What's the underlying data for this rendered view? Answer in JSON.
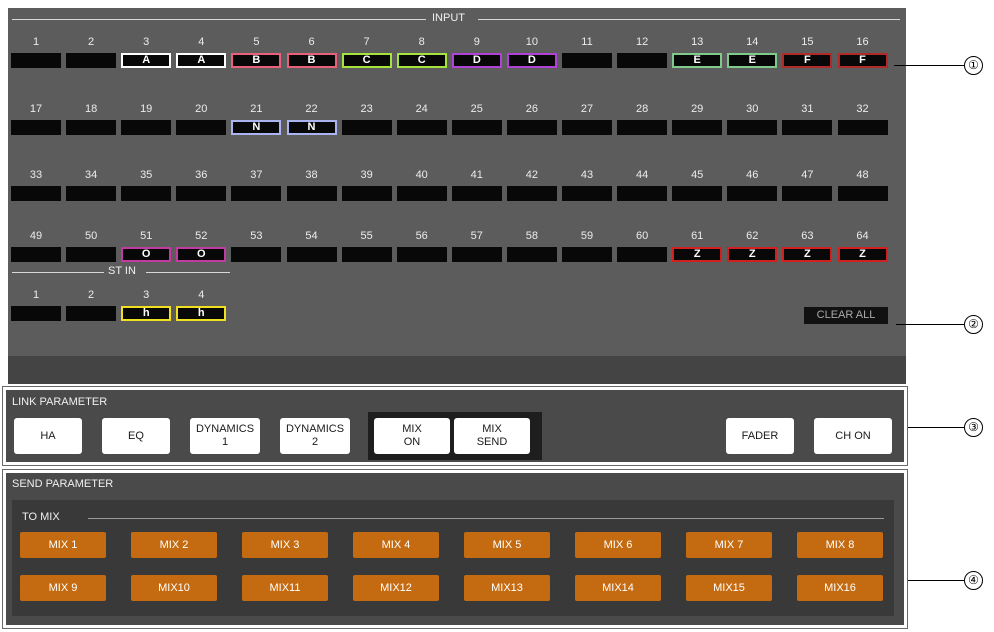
{
  "input": {
    "title": "INPUT",
    "channels": [
      {
        "num": "1",
        "label": "",
        "color": ""
      },
      {
        "num": "2",
        "label": "",
        "color": ""
      },
      {
        "num": "3",
        "label": "A",
        "color": "#ffffff"
      },
      {
        "num": "4",
        "label": "A",
        "color": "#ffffff"
      },
      {
        "num": "5",
        "label": "B",
        "color": "#e8607a"
      },
      {
        "num": "6",
        "label": "B",
        "color": "#e8607a"
      },
      {
        "num": "7",
        "label": "C",
        "color": "#a6e33c"
      },
      {
        "num": "8",
        "label": "C",
        "color": "#a6e33c"
      },
      {
        "num": "9",
        "label": "D",
        "color": "#b042d8"
      },
      {
        "num": "10",
        "label": "D",
        "color": "#b042d8"
      },
      {
        "num": "11",
        "label": "",
        "color": ""
      },
      {
        "num": "12",
        "label": "",
        "color": ""
      },
      {
        "num": "13",
        "label": "E",
        "color": "#7fc98a"
      },
      {
        "num": "14",
        "label": "E",
        "color": "#7fc98a"
      },
      {
        "num": "15",
        "label": "F",
        "color": "#b02a2a"
      },
      {
        "num": "16",
        "label": "F",
        "color": "#b02a2a"
      },
      {
        "num": "17",
        "label": "",
        "color": ""
      },
      {
        "num": "18",
        "label": "",
        "color": ""
      },
      {
        "num": "19",
        "label": "",
        "color": ""
      },
      {
        "num": "20",
        "label": "",
        "color": ""
      },
      {
        "num": "21",
        "label": "N",
        "color": "#aab4f0"
      },
      {
        "num": "22",
        "label": "N",
        "color": "#aab4f0"
      },
      {
        "num": "23",
        "label": "",
        "color": ""
      },
      {
        "num": "24",
        "label": "",
        "color": ""
      },
      {
        "num": "25",
        "label": "",
        "color": ""
      },
      {
        "num": "26",
        "label": "",
        "color": ""
      },
      {
        "num": "27",
        "label": "",
        "color": ""
      },
      {
        "num": "28",
        "label": "",
        "color": ""
      },
      {
        "num": "29",
        "label": "",
        "color": ""
      },
      {
        "num": "30",
        "label": "",
        "color": ""
      },
      {
        "num": "31",
        "label": "",
        "color": ""
      },
      {
        "num": "32",
        "label": "",
        "color": ""
      },
      {
        "num": "33",
        "label": "",
        "color": ""
      },
      {
        "num": "34",
        "label": "",
        "color": ""
      },
      {
        "num": "35",
        "label": "",
        "color": ""
      },
      {
        "num": "36",
        "label": "",
        "color": ""
      },
      {
        "num": "37",
        "label": "",
        "color": ""
      },
      {
        "num": "38",
        "label": "",
        "color": ""
      },
      {
        "num": "39",
        "label": "",
        "color": ""
      },
      {
        "num": "40",
        "label": "",
        "color": ""
      },
      {
        "num": "41",
        "label": "",
        "color": ""
      },
      {
        "num": "42",
        "label": "",
        "color": ""
      },
      {
        "num": "43",
        "label": "",
        "color": ""
      },
      {
        "num": "44",
        "label": "",
        "color": ""
      },
      {
        "num": "45",
        "label": "",
        "color": ""
      },
      {
        "num": "46",
        "label": "",
        "color": ""
      },
      {
        "num": "47",
        "label": "",
        "color": ""
      },
      {
        "num": "48",
        "label": "",
        "color": ""
      },
      {
        "num": "49",
        "label": "",
        "color": ""
      },
      {
        "num": "50",
        "label": "",
        "color": ""
      },
      {
        "num": "51",
        "label": "O",
        "color": "#c03aa0"
      },
      {
        "num": "52",
        "label": "O",
        "color": "#c03aa0"
      },
      {
        "num": "53",
        "label": "",
        "color": ""
      },
      {
        "num": "54",
        "label": "",
        "color": ""
      },
      {
        "num": "55",
        "label": "",
        "color": ""
      },
      {
        "num": "56",
        "label": "",
        "color": ""
      },
      {
        "num": "57",
        "label": "",
        "color": ""
      },
      {
        "num": "58",
        "label": "",
        "color": ""
      },
      {
        "num": "59",
        "label": "",
        "color": ""
      },
      {
        "num": "60",
        "label": "",
        "color": ""
      },
      {
        "num": "61",
        "label": "Z",
        "color": "#d02020"
      },
      {
        "num": "62",
        "label": "Z",
        "color": "#d02020"
      },
      {
        "num": "63",
        "label": "Z",
        "color": "#d02020"
      },
      {
        "num": "64",
        "label": "Z",
        "color": "#d02020"
      }
    ]
  },
  "st_in": {
    "title": "ST IN",
    "channels": [
      {
        "num": "1",
        "label": "",
        "color": ""
      },
      {
        "num": "2",
        "label": "",
        "color": ""
      },
      {
        "num": "3",
        "label": "h",
        "color": "#f0e020"
      },
      {
        "num": "4",
        "label": "h",
        "color": "#f0e020"
      }
    ]
  },
  "clear_all_label": "CLEAR ALL",
  "link_parameter": {
    "title": "LINK PARAMETER",
    "ha": "HA",
    "eq": "EQ",
    "dyn1": [
      "DYNAMICS",
      "1"
    ],
    "dyn2": [
      "DYNAMICS",
      "2"
    ],
    "mix_on": [
      "MIX",
      "ON"
    ],
    "mix_send": [
      "MIX",
      "SEND"
    ],
    "fader": "FADER",
    "ch_on": "CH ON"
  },
  "send_parameter": {
    "title": "SEND PARAMETER",
    "to_mix_title": "TO MIX",
    "buttons": [
      "MIX 1",
      "MIX 2",
      "MIX 3",
      "MIX 4",
      "MIX 5",
      "MIX 6",
      "MIX 7",
      "MIX 8",
      "MIX 9",
      "MIX10",
      "MIX11",
      "MIX12",
      "MIX13",
      "MIX14",
      "MIX15",
      "MIX16"
    ],
    "button_color": "#c46b12"
  },
  "callouts": [
    "①",
    "②",
    "③",
    "④"
  ]
}
